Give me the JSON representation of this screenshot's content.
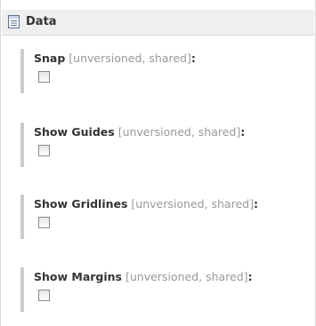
{
  "panel": {
    "title": "Data",
    "icon": "document-list-icon"
  },
  "fields": [
    {
      "name": "Snap",
      "meta": "[unversioned, shared]",
      "colon": ":",
      "checked": false
    },
    {
      "name": "Show Guides",
      "meta": "[unversioned, shared]",
      "colon": ":",
      "checked": false
    },
    {
      "name": "Show Gridlines",
      "meta": "[unversioned, shared]",
      "colon": ":",
      "checked": false
    },
    {
      "name": "Show Margins",
      "meta": "[unversioned, shared]",
      "colon": ":",
      "checked": false
    }
  ],
  "colors": {
    "header_bg": "#efefef",
    "bar": "#cccccc",
    "meta_text": "#999999",
    "text": "#333333"
  }
}
